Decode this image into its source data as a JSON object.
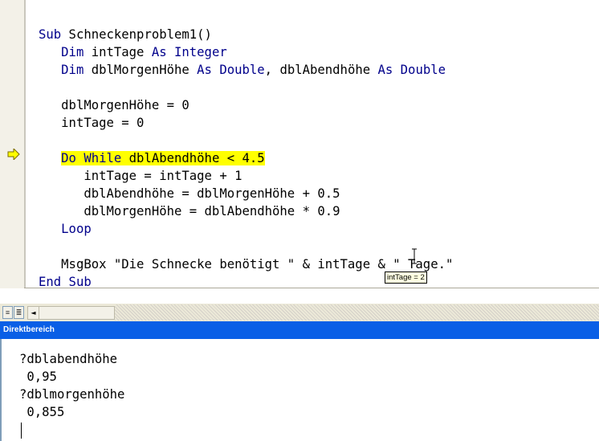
{
  "code_window": {
    "lines": [
      [
        {
          "t": "Sub",
          "k": 1
        },
        {
          "t": " Schneckenproblem1()"
        }
      ],
      [
        {
          "t": "   "
        },
        {
          "t": "Dim",
          "k": 1
        },
        {
          "t": " intTage "
        },
        {
          "t": "As Integer",
          "k": 1
        }
      ],
      [
        {
          "t": "   "
        },
        {
          "t": "Dim",
          "k": 1
        },
        {
          "t": " dblMorgenHöhe "
        },
        {
          "t": "As Double",
          "k": 1
        },
        {
          "t": ", dblAbendhöhe "
        },
        {
          "t": "As Double",
          "k": 1
        }
      ],
      [
        {
          "t": ""
        }
      ],
      [
        {
          "t": "   dblMorgenHöhe = 0"
        }
      ],
      [
        {
          "t": "   intTage = 0"
        }
      ],
      [
        {
          "t": ""
        }
      ],
      [
        {
          "t": "   "
        },
        {
          "t": "Do While",
          "k": 1,
          "h": 1
        },
        {
          "t": " dblAbendhöhe < 4.5",
          "h": 1
        }
      ],
      [
        {
          "t": "      intTage = intTage + 1"
        }
      ],
      [
        {
          "t": "      dblAbendhöhe = dblMorgenHöhe + 0.5"
        }
      ],
      [
        {
          "t": "      dblMorgenHöhe = dblAbendhöhe * 0.9"
        }
      ],
      [
        {
          "t": "   "
        },
        {
          "t": "Loop",
          "k": 1
        }
      ],
      [
        {
          "t": ""
        }
      ],
      [
        {
          "t": "   MsgBox \"Die Schnecke benötigt \" & intTage & \" Tage.\""
        }
      ],
      [
        {
          "t": "End Sub",
          "k": 1
        }
      ]
    ],
    "tooltip": "intTage = 2",
    "execution_marker": "current-line-arrow-icon"
  },
  "scroll_bar": {
    "procedure_view_icon": "≡",
    "module_view_icon": "≣",
    "scroll_left_icon": "◄"
  },
  "immediate_window": {
    "title": "Direktbereich",
    "lines": [
      "?dblabendhöhe",
      " 0,95",
      "?dblmorgenhöhe",
      " 0,855"
    ]
  },
  "colors": {
    "keyword": "#00008b",
    "highlight": "#ffff00",
    "title_bar": "#0a5fe6"
  }
}
